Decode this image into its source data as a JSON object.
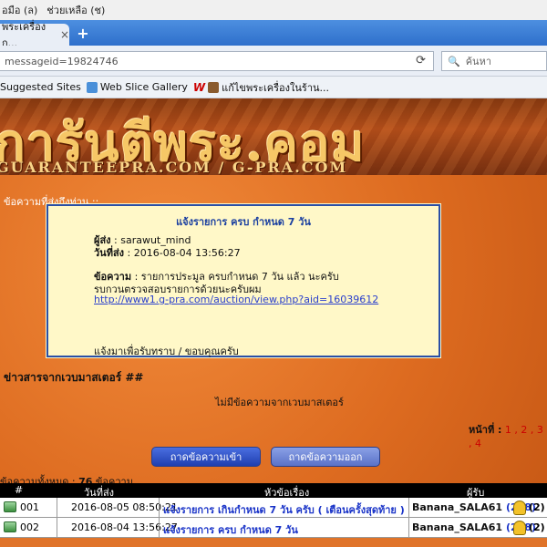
{
  "browser": {
    "menu": [
      "อมือ (ล)",
      "ช่วยเหลือ (ช)"
    ],
    "tab_title": "พระเครื่องก...",
    "tab_close": "×",
    "new_tab": "+",
    "url": "messageid=19824746",
    "search_placeholder": "ค้นหา",
    "bookmarks": [
      "Suggested Sites",
      "Web Slice Gallery",
      "แก้ไขพระเครื่องในร้าน..."
    ]
  },
  "banner": {
    "title": "การันตีพระ.คอม",
    "subtitle": "GUARANTEEPRA.COM / G-PRA.COM"
  },
  "section_label": "ข้อความที่ส่งถึงท่าน ::",
  "message": {
    "title": "แจ้งรายการ ครบ กำหนด 7 วัน",
    "sender_label": "ผู้ส่ง",
    "sender": " : sarawut_mind",
    "date_label": "วันที่ส่ง",
    "date": " : 2016-08-04 13:56:27",
    "body_label": "ข้อความ",
    "body_line1": " : รายการประมูล ครบกำหนด 7 วัน แล้ว นะครับ",
    "body_line2": "รบกวนตรวจสอบรายการด้วยนะครับผม",
    "link": "http://www1.g-pra.com/auction/view.php?aid=16039612",
    "footer": "แจ้งมาเพื่อรับทราบ / ขอบคุณครับ"
  },
  "news": {
    "heading": "ข่าวสารจากเวบมาสเตอร์ ##",
    "empty": "ไม่มีข้อความจากเวบมาสเตอร์"
  },
  "pager": {
    "label": "หน้าที่ :",
    "pages": " 1 , 2 , 3 , 4"
  },
  "buttons": {
    "inbox": "ถาดข้อความเข้า",
    "outbox": "ถาดข้อความออก"
  },
  "total": {
    "label": "ข้อความทั้งหมด :",
    "count": "76",
    "unit": "ข้อความ"
  },
  "table": {
    "headers": [
      "#",
      "วันที่ส่ง",
      "หัวข้อเรื่อง",
      "ผู้รับ"
    ],
    "rows": [
      {
        "no": "001",
        "date": "2016-08-05 08:50:21",
        "subject": "แจ้งรายการ เกินกำหนด 7 วัน ครับ ( เตือนครั้งสุดท้าย )",
        "recipient": "Banana_SALA61",
        "score": "(228)",
        "count": "(2)"
      },
      {
        "no": "002",
        "date": "2016-08-04 13:56:27",
        "subject": "แจ้งรายการ ครบ กำหนด 7 วัน",
        "recipient": "Banana_SALA61",
        "score": "(228)",
        "count": "(2)"
      }
    ]
  },
  "colors": {
    "page_bg": "#e0742a",
    "link_blue": "#1a34c8",
    "message_bg": "#fff8c8",
    "message_border": "#2a4fa6",
    "banner_text": "#f6c766"
  }
}
